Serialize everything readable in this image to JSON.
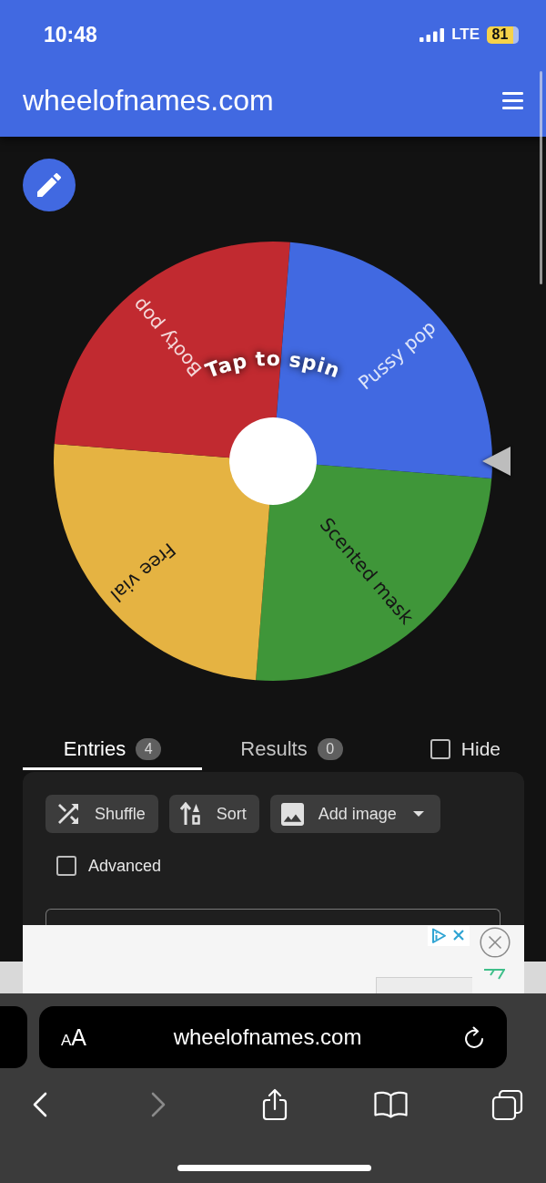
{
  "status_bar": {
    "time": "10:48",
    "network": "LTE",
    "battery": "81"
  },
  "header": {
    "title": "wheelofnames.com"
  },
  "wheel": {
    "prompt": "Tap to spin",
    "segments": [
      {
        "label": "Scented mask",
        "color": "#3f9639"
      },
      {
        "label": "Free vial",
        "color": "#e5b342"
      },
      {
        "label": "Booty pop",
        "color": "#c12a30"
      },
      {
        "label": "Pussy pop",
        "color": "#4169e1"
      }
    ]
  },
  "tabs": [
    {
      "label": "Entries",
      "count": "4",
      "selected": true
    },
    {
      "label": "Results",
      "count": "0",
      "selected": false
    }
  ],
  "hide_option": {
    "label": "Hide",
    "checked": false
  },
  "entry_tools": [
    {
      "kind": "shuffle",
      "label": "Shuffle"
    },
    {
      "kind": "sort",
      "label": "Sort"
    },
    {
      "kind": "image",
      "label": "Add image"
    }
  ],
  "advanced_option": {
    "label": "Advanced",
    "checked": false
  },
  "browser": {
    "text_size_button": "AA",
    "address": "wheelofnames.com",
    "toolbar": [
      {
        "kind": "back",
        "disabled": false
      },
      {
        "kind": "forward",
        "disabled": true
      },
      {
        "kind": "share",
        "disabled": false
      },
      {
        "kind": "bookmarks",
        "disabled": false
      },
      {
        "kind": "tabs",
        "disabled": false
      }
    ]
  }
}
